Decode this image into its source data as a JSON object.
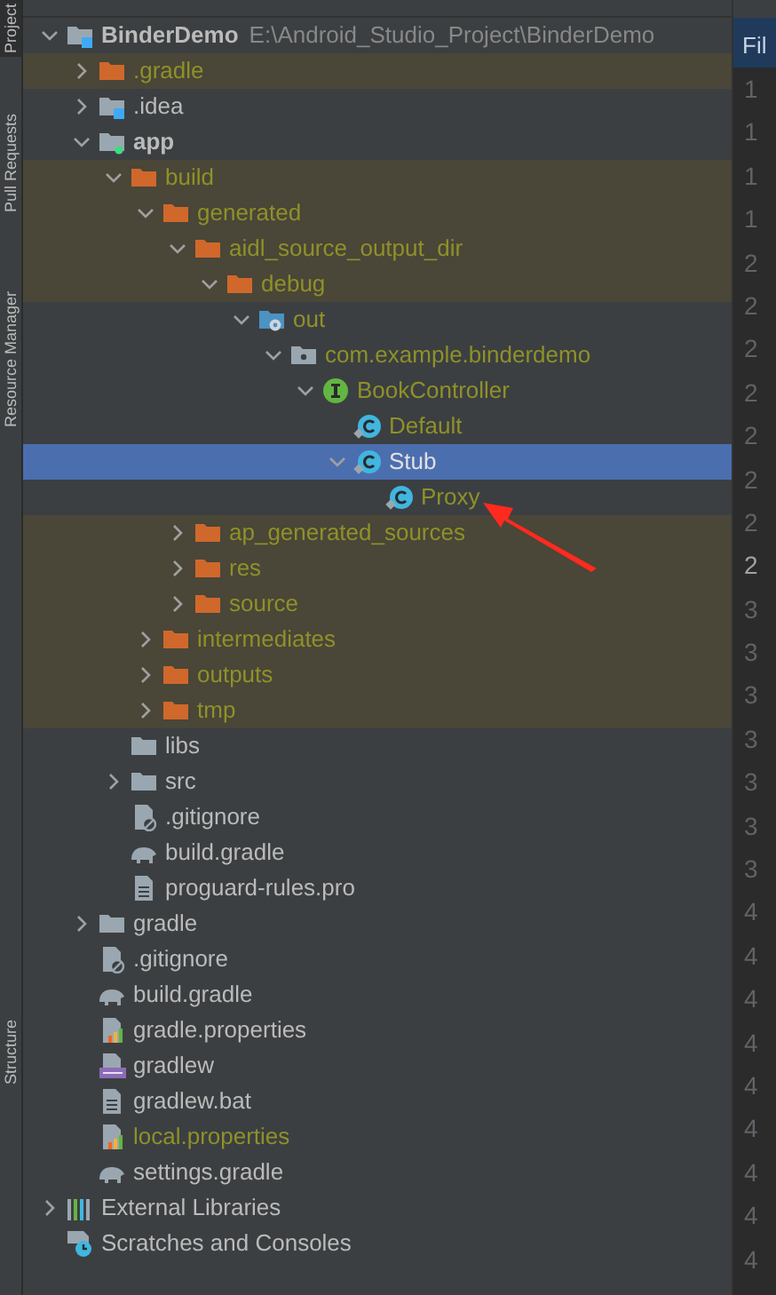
{
  "side_tabs": [
    {
      "label": "Project",
      "selected": true
    },
    {
      "label": "Pull Requests",
      "selected": false
    },
    {
      "label": "Resource Manager",
      "selected": false
    },
    {
      "label": "Structure",
      "selected": false
    }
  ],
  "tree": [
    {
      "label": "BinderDemo",
      "hint": "E:\\Android_Studio_Project\\BinderDemo",
      "kind": "module",
      "expanded": true,
      "bold": true,
      "excluded": false,
      "ignored": false,
      "selected": false,
      "children": [
        {
          "label": ".gradle",
          "kind": "folder-excluded",
          "expanded": false,
          "excluded": true,
          "ignored": true,
          "selected": false
        },
        {
          "label": ".idea",
          "kind": "module",
          "expanded": false,
          "excluded": false,
          "ignored": false,
          "selected": false
        },
        {
          "label": "app",
          "kind": "android-module",
          "expanded": true,
          "bold": true,
          "excluded": false,
          "ignored": false,
          "selected": false,
          "children": [
            {
              "label": "build",
              "kind": "folder-excluded",
              "expanded": true,
              "excluded": true,
              "ignored": true,
              "selected": false,
              "children": [
                {
                  "label": "generated",
                  "kind": "folder-excluded",
                  "expanded": true,
                  "excluded": true,
                  "ignored": true,
                  "selected": false,
                  "children": [
                    {
                      "label": "aidl_source_output_dir",
                      "kind": "folder-excluded",
                      "expanded": true,
                      "excluded": true,
                      "ignored": true,
                      "selected": false,
                      "children": [
                        {
                          "label": "debug",
                          "kind": "folder-excluded",
                          "expanded": true,
                          "excluded": true,
                          "ignored": true,
                          "selected": false,
                          "children": [
                            {
                              "label": "out",
                              "kind": "generated-source",
                              "expanded": true,
                              "excluded": false,
                              "ignored": true,
                              "selected": false,
                              "children": [
                                {
                                  "label": "com.example.binderdemo",
                                  "kind": "package",
                                  "expanded": true,
                                  "excluded": false,
                                  "ignored": true,
                                  "selected": false,
                                  "children": [
                                    {
                                      "label": "BookController",
                                      "kind": "interface",
                                      "expanded": true,
                                      "excluded": false,
                                      "ignored": true,
                                      "selected": false,
                                      "children": [
                                        {
                                          "label": "Default",
                                          "kind": "class",
                                          "excluded": false,
                                          "ignored": true,
                                          "selected": false
                                        },
                                        {
                                          "label": "Stub",
                                          "kind": "class",
                                          "expanded": true,
                                          "excluded": false,
                                          "ignored": true,
                                          "selected": true,
                                          "children": [
                                            {
                                              "label": "Proxy",
                                              "kind": "class",
                                              "excluded": false,
                                              "ignored": true,
                                              "selected": false
                                            }
                                          ]
                                        }
                                      ]
                                    }
                                  ]
                                }
                              ]
                            }
                          ]
                        }
                      ]
                    },
                    {
                      "label": "ap_generated_sources",
                      "kind": "folder-excluded",
                      "expanded": false,
                      "excluded": true,
                      "ignored": true,
                      "selected": false
                    },
                    {
                      "label": "res",
                      "kind": "folder-excluded",
                      "expanded": false,
                      "excluded": true,
                      "ignored": true,
                      "selected": false
                    },
                    {
                      "label": "source",
                      "kind": "folder-excluded",
                      "expanded": false,
                      "excluded": true,
                      "ignored": true,
                      "selected": false
                    }
                  ]
                },
                {
                  "label": "intermediates",
                  "kind": "folder-excluded",
                  "expanded": false,
                  "excluded": true,
                  "ignored": true,
                  "selected": false
                },
                {
                  "label": "outputs",
                  "kind": "folder-excluded",
                  "expanded": false,
                  "excluded": true,
                  "ignored": true,
                  "selected": false
                },
                {
                  "label": "tmp",
                  "kind": "folder-excluded",
                  "expanded": false,
                  "excluded": true,
                  "ignored": true,
                  "selected": false
                }
              ]
            },
            {
              "label": "libs",
              "kind": "folder",
              "excluded": false,
              "ignored": false,
              "selected": false
            },
            {
              "label": "src",
              "kind": "folder",
              "expanded": false,
              "excluded": false,
              "ignored": false,
              "selected": false
            },
            {
              "label": ".gitignore",
              "kind": "gitignore",
              "excluded": false,
              "ignored": false,
              "selected": false
            },
            {
              "label": "build.gradle",
              "kind": "gradle",
              "excluded": false,
              "ignored": false,
              "selected": false
            },
            {
              "label": "proguard-rules.pro",
              "kind": "text",
              "excluded": false,
              "ignored": false,
              "selected": false
            }
          ]
        },
        {
          "label": "gradle",
          "kind": "folder",
          "expanded": false,
          "excluded": false,
          "ignored": false,
          "selected": false
        },
        {
          "label": ".gitignore",
          "kind": "gitignore",
          "excluded": false,
          "ignored": false,
          "selected": false
        },
        {
          "label": "build.gradle",
          "kind": "gradle",
          "excluded": false,
          "ignored": false,
          "selected": false
        },
        {
          "label": "gradle.properties",
          "kind": "properties",
          "excluded": false,
          "ignored": false,
          "selected": false
        },
        {
          "label": "gradlew",
          "kind": "script",
          "excluded": false,
          "ignored": false,
          "selected": false
        },
        {
          "label": "gradlew.bat",
          "kind": "text",
          "excluded": false,
          "ignored": false,
          "selected": false
        },
        {
          "label": "local.properties",
          "kind": "properties",
          "excluded": false,
          "ignored": true,
          "selected": false
        },
        {
          "label": "settings.gradle",
          "kind": "gradle",
          "excluded": false,
          "ignored": false,
          "selected": false
        }
      ]
    },
    {
      "label": "External Libraries",
      "kind": "libraries",
      "expanded": false,
      "excluded": false,
      "ignored": false,
      "selected": false
    },
    {
      "label": "Scratches and Consoles",
      "kind": "scratches",
      "excluded": false,
      "ignored": false,
      "selected": false
    }
  ],
  "editor": {
    "tab": "Fil",
    "line_numbers": [
      {
        "text": "1",
        "current": false
      },
      {
        "text": "1",
        "current": false
      },
      {
        "text": "1",
        "current": false
      },
      {
        "text": "1",
        "current": false
      },
      {
        "text": "2",
        "current": false
      },
      {
        "text": "2",
        "current": false
      },
      {
        "text": "2",
        "current": false
      },
      {
        "text": "2",
        "current": false
      },
      {
        "text": "2",
        "current": false
      },
      {
        "text": "2",
        "current": false
      },
      {
        "text": "2",
        "current": false
      },
      {
        "text": "2",
        "current": true
      },
      {
        "text": "3",
        "current": false
      },
      {
        "text": "3",
        "current": false
      },
      {
        "text": "3",
        "current": false
      },
      {
        "text": "3",
        "current": false
      },
      {
        "text": "3",
        "current": false
      },
      {
        "text": "3",
        "current": false
      },
      {
        "text": "3",
        "current": false
      },
      {
        "text": "4",
        "current": false
      },
      {
        "text": "4",
        "current": false
      },
      {
        "text": "4",
        "current": false
      },
      {
        "text": "4",
        "current": false
      },
      {
        "text": "4",
        "current": false
      },
      {
        "text": "4",
        "current": false
      },
      {
        "text": "4",
        "current": false
      },
      {
        "text": "4",
        "current": false
      },
      {
        "text": "4",
        "current": false
      }
    ]
  }
}
